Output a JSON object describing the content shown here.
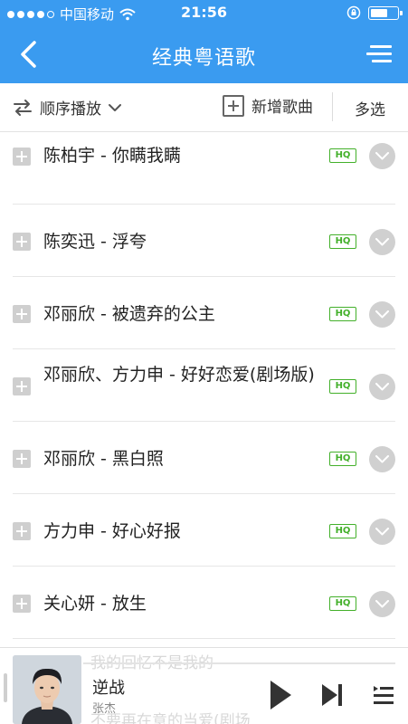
{
  "status": {
    "carrier": "中国移动",
    "time": "21:56"
  },
  "nav": {
    "title": "经典粤语歌"
  },
  "toolbar": {
    "order_label": "顺序播放",
    "add_label": "新增歌曲",
    "multi_label": "多选"
  },
  "songs": [
    {
      "title": "陈柏宇 - 你瞒我瞒",
      "badge": "HQ"
    },
    {
      "title": "陈奕迅 - 浮夸",
      "badge": "HQ"
    },
    {
      "title": "邓丽欣 - 被遗弃的公主",
      "badge": "HQ"
    },
    {
      "title": "邓丽欣、方力申 - 好好恋爱(剧场版)",
      "badge": "HQ"
    },
    {
      "title": "邓丽欣 - 黑白照",
      "badge": "HQ"
    },
    {
      "title": "方力申 - 好心好报",
      "badge": "HQ"
    },
    {
      "title": "关心妍 - 放生",
      "badge": "HQ"
    }
  ],
  "player": {
    "song": "逆战",
    "artist": "张杰",
    "behind_text_top": "我的回忆不是我的",
    "behind_text_bottom": "不要再在意的当爱(剧场"
  },
  "colors": {
    "primary": "#3a9bf0",
    "hq": "#43b02a"
  },
  "icons": [
    "back-arrow-icon",
    "menu-icon",
    "repeat-order-icon",
    "chevron-down-icon",
    "add-song-icon",
    "add-to-list-icon",
    "more-chevron-icon",
    "play-icon",
    "next-icon",
    "playlist-icon"
  ]
}
